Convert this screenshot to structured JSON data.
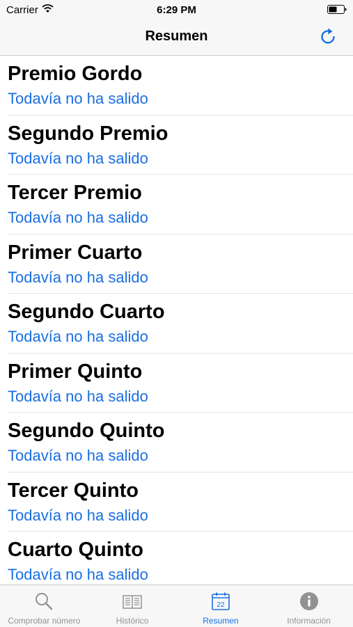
{
  "status_bar": {
    "carrier": "Carrier",
    "time": "6:29 PM"
  },
  "nav": {
    "title": "Resumen",
    "refresh_icon": "refresh-icon"
  },
  "list": {
    "items": [
      {
        "title": "Premio Gordo",
        "status": "Todavía no ha salido"
      },
      {
        "title": "Segundo Premio",
        "status": "Todavía no ha salido"
      },
      {
        "title": "Tercer Premio",
        "status": "Todavía no ha salido"
      },
      {
        "title": "Primer Cuarto",
        "status": "Todavía no ha salido"
      },
      {
        "title": "Segundo Cuarto",
        "status": "Todavía no ha salido"
      },
      {
        "title": "Primer Quinto",
        "status": "Todavía no ha salido"
      },
      {
        "title": "Segundo Quinto",
        "status": "Todavía no ha salido"
      },
      {
        "title": "Tercer Quinto",
        "status": "Todavía no ha salido"
      },
      {
        "title": "Cuarto Quinto",
        "status": "Todavía no ha salido"
      }
    ]
  },
  "tabs": [
    {
      "label": "Comprobar número",
      "icon": "search-icon",
      "active": false
    },
    {
      "label": "Histórico",
      "icon": "book-icon",
      "active": false
    },
    {
      "label": "Resumen",
      "icon": "calendar-icon",
      "calendar_day": "22",
      "active": true
    },
    {
      "label": "Información",
      "icon": "info-icon",
      "active": false
    }
  ],
  "colors": {
    "accent": "#1a6fe0",
    "inactive": "#929292",
    "bar_background": "#f7f7f7"
  }
}
